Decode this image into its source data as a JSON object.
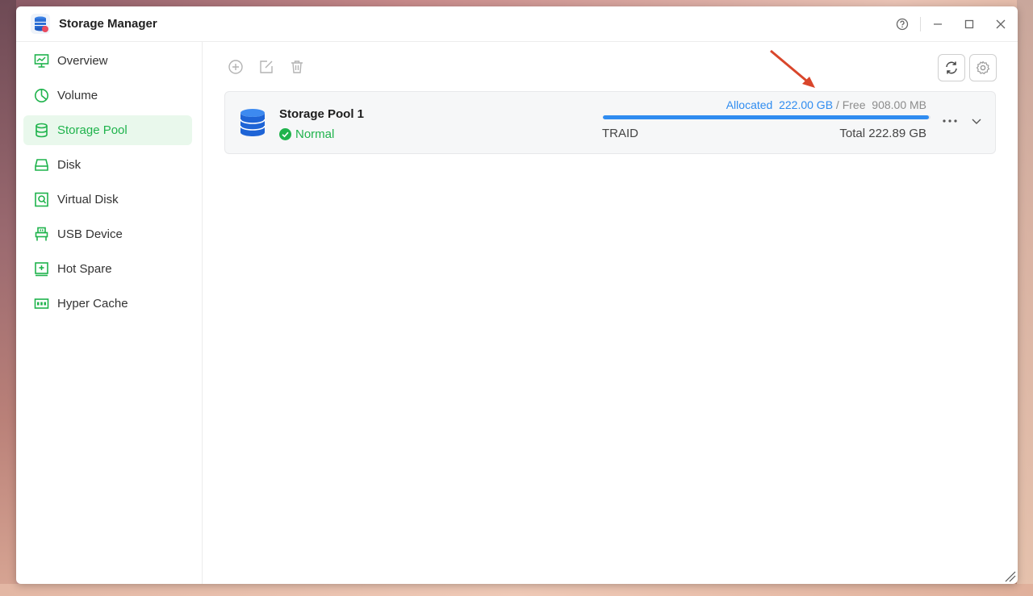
{
  "window": {
    "title": "Storage Manager"
  },
  "sidebar": {
    "items": [
      {
        "label": "Overview",
        "icon": "monitor-chart-icon"
      },
      {
        "label": "Volume",
        "icon": "clock-pie-icon"
      },
      {
        "label": "Storage Pool",
        "icon": "database-icon",
        "active": true
      },
      {
        "label": "Disk",
        "icon": "hard-drive-icon"
      },
      {
        "label": "Virtual Disk",
        "icon": "virtual-disk-icon"
      },
      {
        "label": "USB Device",
        "icon": "usb-icon"
      },
      {
        "label": "Hot Spare",
        "icon": "hot-spare-icon"
      },
      {
        "label": "Hyper Cache",
        "icon": "ssd-icon"
      }
    ]
  },
  "toolbar": {
    "add": "add-icon",
    "edit": "edit-icon",
    "delete": "trash-icon",
    "refresh": "refresh-icon",
    "settings": "gear-icon"
  },
  "pool": {
    "name": "Storage Pool 1",
    "status": "Normal",
    "allocated_label": "Allocated",
    "allocated_value": "222.00 GB",
    "separator": "/",
    "free_label": "Free",
    "free_value": "908.00 MB",
    "raid_type": "TRAID",
    "total_label": "Total",
    "total_value": "222.89 GB",
    "usage_fraction": 0.996
  },
  "colors": {
    "accent_green": "#1fb34c",
    "accent_blue": "#2f8cf0",
    "annotation_red": "#d9462b"
  }
}
